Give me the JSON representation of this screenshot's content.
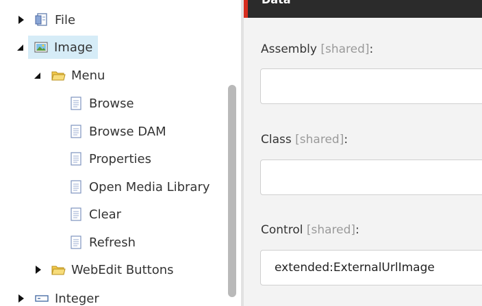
{
  "tree": {
    "items": [
      {
        "label": "File",
        "icon": "file-template-icon",
        "state": "collapsed"
      },
      {
        "label": "Image",
        "icon": "image-icon",
        "state": "expanded",
        "selected": true
      },
      {
        "label": "Menu",
        "icon": "folder-icon",
        "state": "expanded"
      },
      {
        "label": "Browse",
        "icon": "document-icon"
      },
      {
        "label": "Browse DAM",
        "icon": "document-icon"
      },
      {
        "label": "Properties",
        "icon": "document-icon"
      },
      {
        "label": "Open Media Library",
        "icon": "document-icon"
      },
      {
        "label": "Clear",
        "icon": "document-icon"
      },
      {
        "label": "Refresh",
        "icon": "document-icon"
      },
      {
        "label": "WebEdit Buttons",
        "icon": "folder-icon",
        "state": "collapsed"
      },
      {
        "label": "Integer",
        "icon": "integer-field-icon",
        "state": "collapsed"
      }
    ]
  },
  "panel": {
    "section_title": "Data",
    "accent_color": "#d62d1e",
    "fields": [
      {
        "label": "Assembly",
        "shared": "[shared]",
        "colon": ":",
        "value": ""
      },
      {
        "label": "Class",
        "shared": "[shared]",
        "colon": ":",
        "value": ""
      },
      {
        "label": "Control",
        "shared": "[shared]",
        "colon": ":",
        "value": "extended:ExternalUrlImage"
      }
    ]
  }
}
